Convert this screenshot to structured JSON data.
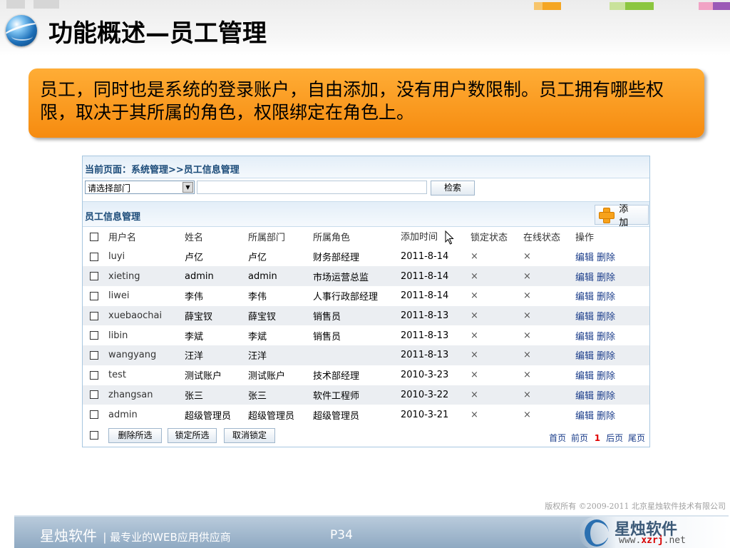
{
  "slide": {
    "title": "功能概述—员工管理",
    "callout_text": "员工，同时也是系统的登录账户，自由添加，没有用户数限制。员工拥有哪些权限，取决于其所属的角色，权限绑定在角色上。",
    "colors": {
      "callout": "#f68b0f",
      "deco": [
        "#f5a623",
        "#8cc63f",
        "#e05a9a"
      ]
    }
  },
  "app": {
    "breadcrumb": "当前页面：系统管理>>员工信息管理",
    "search": {
      "dept_selected": "请选择部门",
      "input_value": "",
      "button_label": "检索"
    },
    "section_title": "员工信息管理",
    "add_button_label": "添 加",
    "table": {
      "headers": [
        "用户名",
        "姓名",
        "所属部门",
        "所属角色",
        "添加时间",
        "锁定状态",
        "在线状态",
        "操作"
      ],
      "rows": [
        {
          "user": "luyi",
          "name": "卢亿",
          "dept": "卢亿",
          "role": "财务部经理",
          "time": "2011-8-14",
          "locked": "×",
          "online": "×"
        },
        {
          "user": "xieting",
          "name": "admin",
          "dept": "admin",
          "role": "市场运营总监",
          "time": "2011-8-14",
          "locked": "×",
          "online": "×"
        },
        {
          "user": "liwei",
          "name": "李伟",
          "dept": "李伟",
          "role": "人事行政部经理",
          "time": "2011-8-14",
          "locked": "×",
          "online": "×"
        },
        {
          "user": "xuebaochai",
          "name": "薛宝钗",
          "dept": "薛宝钗",
          "role": "销售员",
          "time": "2011-8-13",
          "locked": "×",
          "online": "×"
        },
        {
          "user": "libin",
          "name": "李斌",
          "dept": "李斌",
          "role": "销售员",
          "time": "2011-8-13",
          "locked": "×",
          "online": "×"
        },
        {
          "user": "wangyang",
          "name": "汪洋",
          "dept": "汪洋",
          "role": "",
          "time": "2011-8-13",
          "locked": "×",
          "online": "×"
        },
        {
          "user": "test",
          "name": "测试账户",
          "dept": "测试账户",
          "role": "技术部经理",
          "time": "2010-3-23",
          "locked": "×",
          "online": "×"
        },
        {
          "user": "zhangsan",
          "name": "张三",
          "dept": "张三",
          "role": "软件工程师",
          "time": "2010-3-22",
          "locked": "×",
          "online": "×"
        },
        {
          "user": "admin",
          "name": "超级管理员",
          "dept": "超级管理员",
          "role": "超级管理员",
          "time": "2010-3-21",
          "locked": "×",
          "online": "×"
        }
      ],
      "edit_label": "编辑",
      "delete_label": "删除"
    },
    "bulk_actions": {
      "delete_selected": "删除所选",
      "lock_selected": "锁定所选",
      "unlock": "取消锁定"
    },
    "pager": {
      "first": "首页",
      "prev": "前页",
      "current": "1",
      "next": "后页",
      "last": "尾页"
    }
  },
  "footer": {
    "copyright": "版权所有 ©2009-2011 北京星烛软件技术有限公司",
    "brand": "星烛软件",
    "slogan": "| 最专业的WEB应用供应商",
    "page_number": "P34",
    "logo_text": "星烛软件",
    "logo_url_prefix": "www.",
    "logo_url_highlight": "xzrj",
    "logo_url_suffix": ".net"
  }
}
